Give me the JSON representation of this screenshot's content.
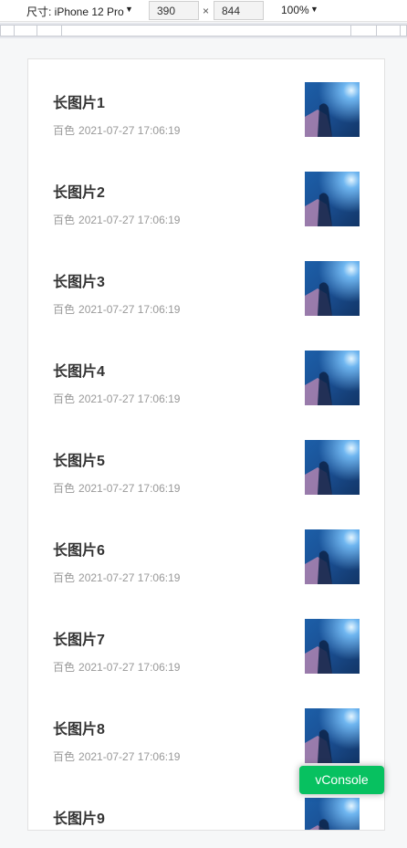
{
  "devtools": {
    "device_label": "尺寸: iPhone 12 Pro",
    "width_value": "390",
    "times_symbol": "×",
    "height_value": "844",
    "zoom_value": "100%",
    "caret_icon": "caret-down-icon"
  },
  "list": {
    "items": [
      {
        "title": "长图片1",
        "author": "百色",
        "datetime": "2021-07-27 17:06:19"
      },
      {
        "title": "长图片2",
        "author": "百色",
        "datetime": "2021-07-27 17:06:19"
      },
      {
        "title": "长图片3",
        "author": "百色",
        "datetime": "2021-07-27 17:06:19"
      },
      {
        "title": "长图片4",
        "author": "百色",
        "datetime": "2021-07-27 17:06:19"
      },
      {
        "title": "长图片5",
        "author": "百色",
        "datetime": "2021-07-27 17:06:19"
      },
      {
        "title": "长图片6",
        "author": "百色",
        "datetime": "2021-07-27 17:06:19"
      },
      {
        "title": "长图片7",
        "author": "百色",
        "datetime": "2021-07-27 17:06:19"
      },
      {
        "title": "长图片8",
        "author": "百色",
        "datetime": "2021-07-27 17:06:19"
      },
      {
        "title": "长图片9",
        "author": "",
        "datetime": ""
      }
    ]
  },
  "vconsole": {
    "label": "vConsole",
    "color": "#07c160"
  }
}
